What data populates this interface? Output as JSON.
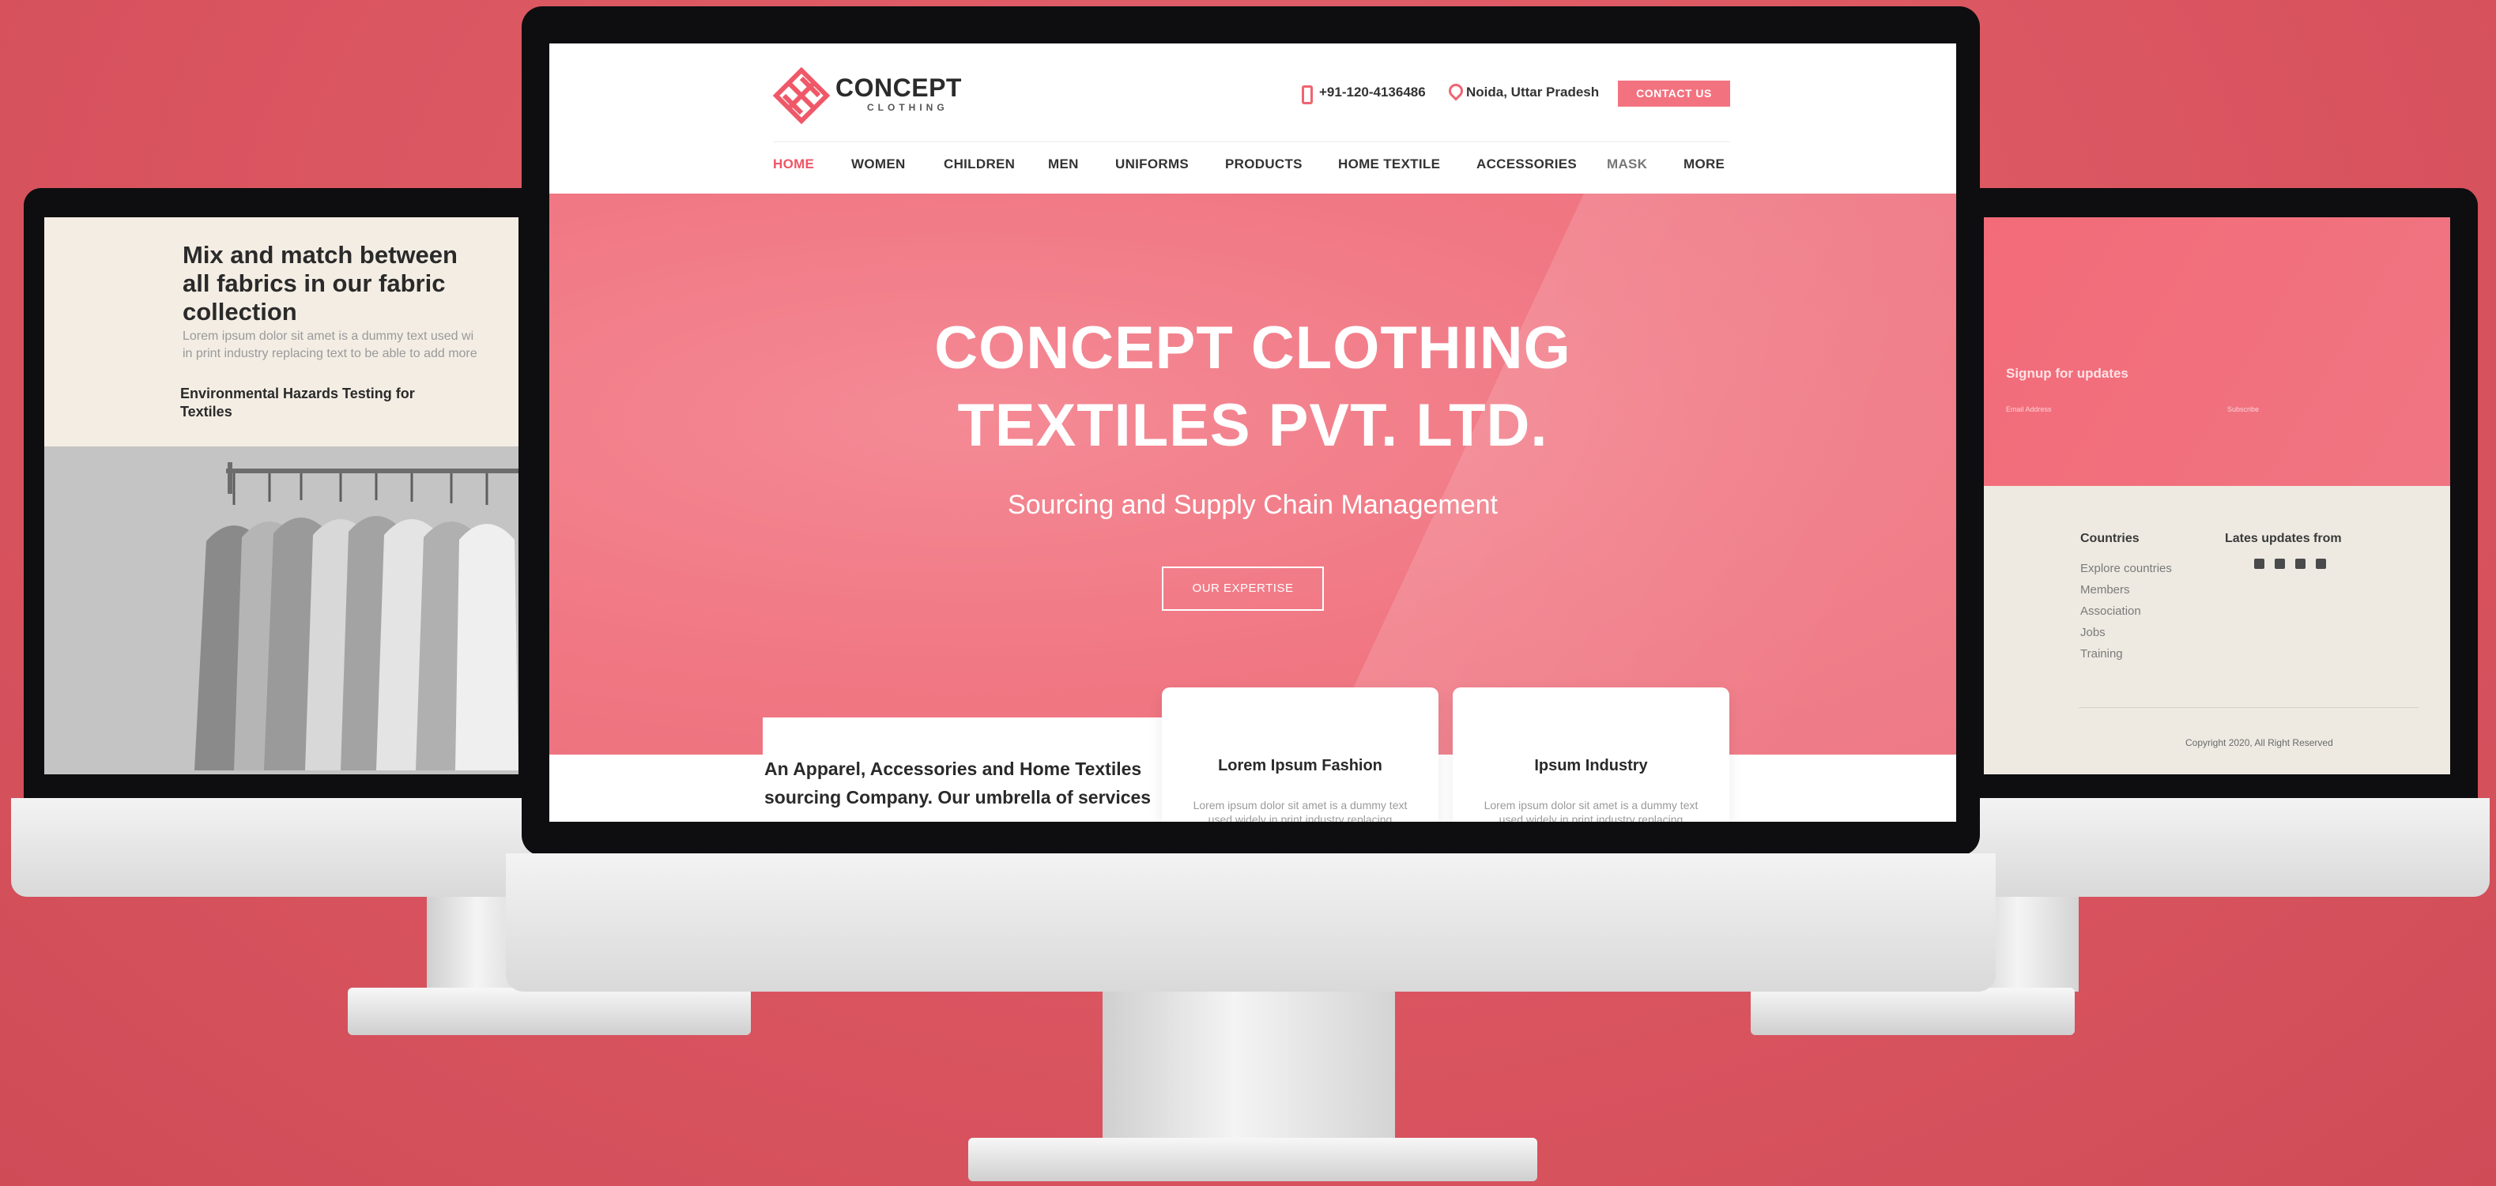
{
  "left_site": {
    "heading_lines": [
      "Mix and match between",
      "all fabrics in our fabric",
      "collection"
    ],
    "lorem_lines": [
      "Lorem ipsum dolor sit amet is a dummy text used wi",
      "in print industry replacing text to be able to add more"
    ],
    "subheading_lines": [
      "Environmental Hazards Testing for",
      "Textiles"
    ]
  },
  "right_site": {
    "signup_title": "Signup for updates",
    "email_label": "Email Address",
    "subscribe_label": "Subscribe",
    "countries_heading": "Countries",
    "countries_links": [
      "Explore countries",
      "Members",
      "Association",
      "Jobs",
      "Training"
    ],
    "updates_heading": "Lates updates from",
    "social_icons": [
      "twitter-icon",
      "linkedin-icon",
      "facebook-icon",
      "instagram-icon"
    ],
    "copyright": "Copyright 2020, All Right Reserved"
  },
  "header": {
    "logo_title": "CONCEPT",
    "logo_subtitle": "CLOTHING",
    "phone": "+91-120-4136486",
    "location": "Noida, Uttar Pradesh",
    "contact_button": "CONTACT US"
  },
  "nav": {
    "items": [
      "HOME",
      "WOMEN",
      "CHILDREN",
      "MEN",
      "UNIFORMS",
      "PRODUCTS",
      "HOME TEXTILE",
      "ACCESSORIES",
      "MASK",
      "MORE"
    ],
    "active": "HOME"
  },
  "hero": {
    "title_lines": [
      "CONCEPT CLOTHING",
      "TEXTILES PVT. LTD."
    ],
    "subtitle": "Sourcing and Supply Chain Management",
    "cta": "OUR EXPERTISE"
  },
  "intro": {
    "lines": [
      "An Apparel, Accessories and Home Textiles",
      "sourcing Company. Our umbrella of services"
    ]
  },
  "cards": [
    {
      "title": "Lorem Ipsum Fashion",
      "body": "Lorem ipsum dolor sit amet is a dummy text used widely in print industry replacing"
    },
    {
      "title": "Ipsum Industry",
      "body": "Lorem ipsum dolor sit amet is a dummy text used widely in print industry replacing"
    }
  ],
  "colors": {
    "accent": "#f3727f",
    "active_nav": "#ef5565",
    "background": "#d9545f"
  }
}
